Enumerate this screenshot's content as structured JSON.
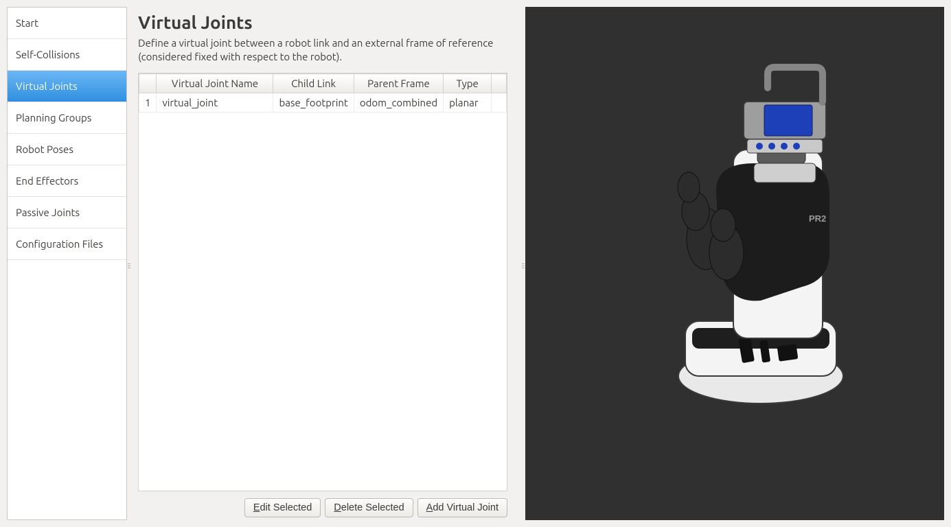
{
  "sidebar": {
    "items": [
      {
        "label": "Start"
      },
      {
        "label": "Self-Collisions"
      },
      {
        "label": "Virtual Joints"
      },
      {
        "label": "Planning Groups"
      },
      {
        "label": "Robot Poses"
      },
      {
        "label": "End Effectors"
      },
      {
        "label": "Passive Joints"
      },
      {
        "label": "Configuration Files"
      }
    ],
    "active_index": 2
  },
  "main": {
    "title": "Virtual Joints",
    "description": "Define a virtual joint between a robot link and an external frame of reference (considered fixed with respect to the robot).",
    "columns": {
      "c1": "Virtual Joint Name",
      "c2": "Child Link",
      "c3": "Parent Frame",
      "c4": "Type"
    },
    "rows": [
      {
        "n": "1",
        "name": "virtual_joint",
        "child_link": "base_footprint",
        "parent_frame": "odom_combined",
        "type": "planar"
      }
    ],
    "buttons": {
      "edit_prefix": "E",
      "edit_rest": "dit Selected",
      "delete_prefix": "D",
      "delete_rest": "elete Selected",
      "add_prefix": "A",
      "add_rest": "dd Virtual Joint"
    }
  },
  "viewport": {
    "robot_label": "PR2"
  }
}
